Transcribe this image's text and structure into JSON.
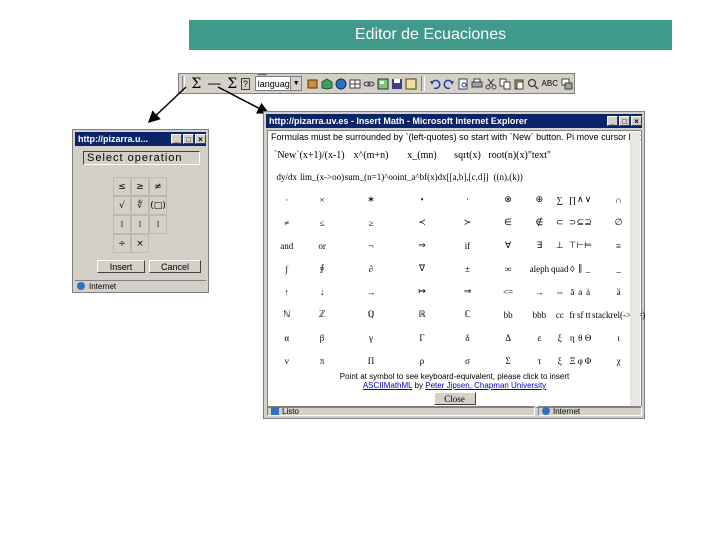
{
  "banner": {
    "title": "Editor de Ecuaciones"
  },
  "toolbar": {
    "sigma1": "Σ",
    "dash": "—",
    "sigma2": "Σ",
    "help": "?",
    "language_select": "—language—",
    "abc": "ABC"
  },
  "small_window": {
    "title": "http://pizarra.u...",
    "heading": "Select operation",
    "ops": [
      "≤",
      "≥",
      "≠",
      "√",
      "∜",
      "(□)",
      "⁞",
      "⁞",
      "⁞",
      "÷",
      "×",
      ""
    ],
    "insert_label": "Insert",
    "cancel_label": "Cancel",
    "status": "Internet"
  },
  "big_window": {
    "title": "http://pizarra.uv.es - Insert Math - Microsoft Internet Explorer",
    "instructions": "Formulas must be surrounded by `(left-quotes) so start with `New` button. Pi move cursor left",
    "rows": [
      [
        "`New`",
        "(x+1)/(x-1)",
        "x^(m+n)",
        "x_(mn)",
        "sqrt(x)",
        "root(n)(x)",
        "\"text\""
      ],
      [
        "dy/dx",
        "lim_(x->oo)",
        "sum_(n=1)^oo",
        "int_a^bf(x)dx",
        "[[a,b],[c,d]]",
        "((n),(k))"
      ],
      [
        "·",
        "×",
        "∗",
        "⋆",
        "⋅",
        "⊗",
        "⊕",
        "∑",
        "∏",
        "∧",
        "∨",
        "∩",
        "∪"
      ],
      [
        "≠",
        "≤",
        "≥",
        "≺",
        "≻",
        "∈",
        "∉",
        "⊂",
        "⊃",
        "⊆",
        "⊇",
        "∅",
        "∩"
      ],
      [
        "and",
        "or",
        "¬",
        "⇒",
        "if",
        "∀",
        "∃",
        "⊥",
        "⊤",
        "⊢",
        "⊨",
        "≡",
        "⇔"
      ],
      [
        "∫",
        "∮",
        "∂",
        "∇",
        "±",
        "∞",
        "aleph",
        "quad",
        "◊",
        "∥",
        "_",
        "_",
        "⊢"
      ],
      [
        "↑",
        "↓",
        "→",
        "↦",
        "⇒",
        "<=",
        "→",
        "⇔",
        "ā",
        "a",
        "ȧ",
        "ä",
        "vec"
      ],
      [
        "ℕ",
        "ℤ",
        "ℚ",
        "ℝ",
        "ℂ",
        "bb",
        "bbb",
        "cc",
        "fr",
        "sf",
        "tt",
        "stackrel(->)(=)",
        "υ"
      ],
      [
        "α",
        "β",
        "γ",
        "Γ",
        "δ",
        "Δ",
        "ε",
        "ξ",
        "η",
        "θ",
        "Θ",
        "ι",
        "κ",
        "λ",
        "Λ",
        "μ"
      ],
      [
        "ν",
        "π",
        "Π",
        "ρ",
        "σ",
        "Σ",
        "τ",
        "ξ",
        "Ξ",
        "φ",
        "Φ",
        "χ",
        "ψ",
        "Ψ",
        "ω",
        "Ω"
      ]
    ],
    "footer_line1": "Point at symbol to see keyboard-equivalent, please click to insert",
    "footer_link": "ASCIIMathML",
    "footer_by": "by",
    "footer_author": "Peter Jipsen, Chapman University",
    "close_label": "Close",
    "status_left": "Listo",
    "status_right": "Internet"
  },
  "colors": {
    "banner_bg": "#3f9a8c",
    "titlebar": "#0a246a",
    "window_bg": "#d4d0c8"
  }
}
